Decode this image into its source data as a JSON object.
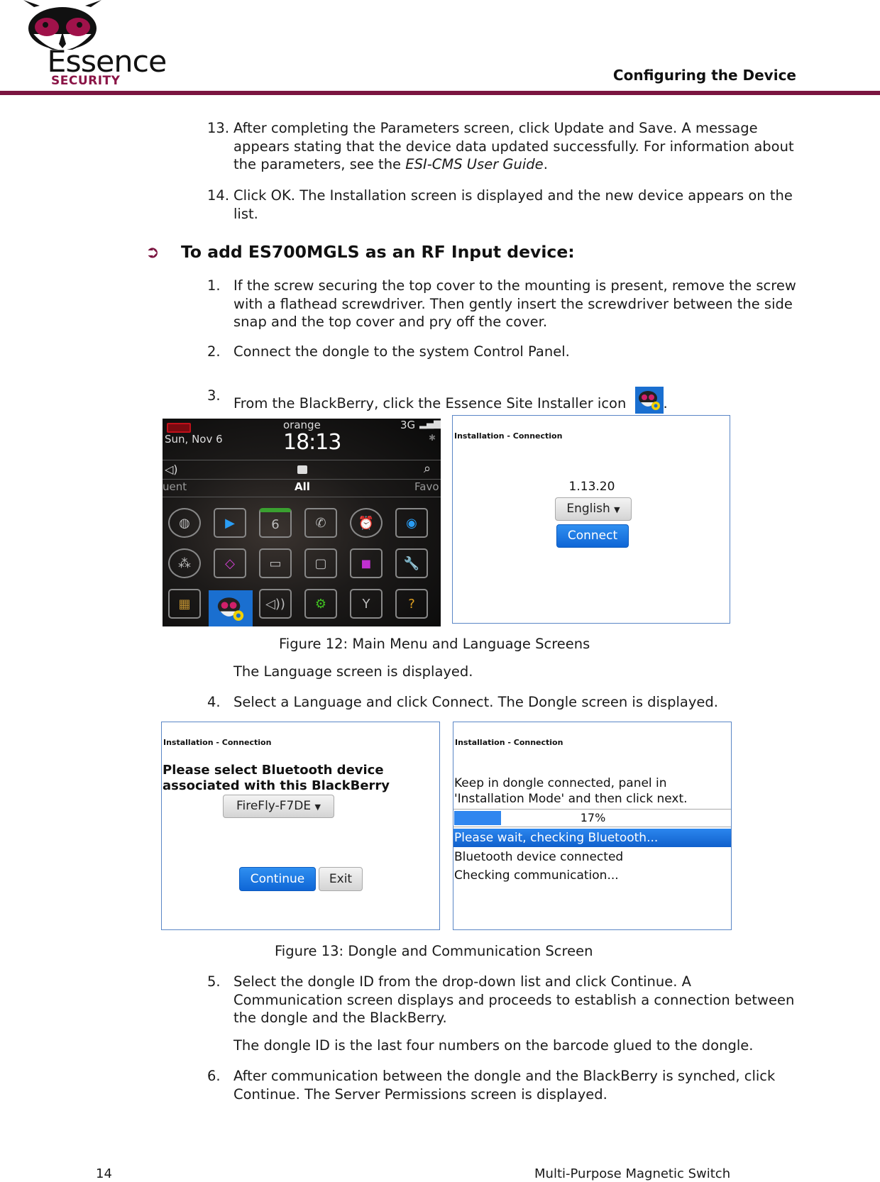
{
  "header": {
    "logo_word": "Essence",
    "logo_sub": "SECURITY",
    "section_title": "Configuring the Device",
    "accent_color": "#7b1540"
  },
  "steps_prev": [
    {
      "num": "13.",
      "text_a": "After completing the Parameters screen, click Update and Save. A message appears stating that the device data updated successfully. For information about the parameters, see the ",
      "text_em": "ESI-CMS User Guide",
      "text_b": "."
    },
    {
      "num": "14.",
      "text": "Click OK. The Installation screen is displayed and the new device appears on the list."
    }
  ],
  "procedure": {
    "arrow": "➲",
    "title": "To add ES700MGLS as an RF Input device:",
    "steps": [
      {
        "num": "1.",
        "text": "If the screw securing the top cover to the mounting is present, remove the screw with a flathead screwdriver. Then gently insert the screwdriver between the side snap and the top cover and pry off the cover."
      },
      {
        "num": "2.",
        "text": "Connect the dongle to the system Control Panel."
      },
      {
        "num": "3.",
        "text": "From the BlackBerry, click the Essence Site Installer icon",
        "suffix": "."
      },
      {
        "num": "4.",
        "text": "Select a Language and click Connect. The Dongle screen is displayed."
      },
      {
        "num": "5.",
        "text": "Select the dongle ID from the drop-down list and click Continue. A Communication screen displays and proceeds to establish a connection between the dongle and the BlackBerry."
      },
      {
        "num": "6.",
        "text": "After communication between the dongle and the BlackBerry is synched, click Continue. The Server Permissions screen is displayed."
      }
    ],
    "note_after_fig12": "The Language screen is displayed.",
    "note_after_step5": "The dongle ID is the last four numbers on the barcode glued to the dongle."
  },
  "figure12": {
    "caption": "Figure 12: Main Menu and Language Screens",
    "phone": {
      "carrier": "orange",
      "time": "18:13",
      "date": "Sun, Nov 6",
      "network": "3G",
      "tabs": [
        "uent",
        "All",
        "Favo"
      ],
      "calendar_day": "6",
      "icons": [
        "browser-icon",
        "media-icon",
        "calendar-icon",
        "phone-icon",
        "clock-icon",
        "camera-icon",
        "blackberry-icon",
        "maps-icon",
        "messages-icon",
        "folder-icon",
        "games-icon",
        "options-icon",
        "sim-icon",
        "essence-site-installer-icon",
        "sound-icon",
        "setup-icon",
        "network-icon",
        "help-icon"
      ]
    },
    "language_screen": {
      "title": "Installation - Connection",
      "version": "1.13.20",
      "language_selected": "English",
      "connect_label": "Connect"
    }
  },
  "figure13": {
    "caption": "Figure 13: Dongle and Communication Screen",
    "dongle_screen": {
      "title": "Installation - Connection",
      "prompt_line1": "Please select Bluetooth device",
      "prompt_line2": "associated with this BlackBerry",
      "device_selected": "FireFly-F7DE",
      "continue_label": "Continue",
      "exit_label": "Exit"
    },
    "communication_screen": {
      "title": "Installation - Connection",
      "message_line1": "Keep in dongle connected, panel in",
      "message_line2": "'Installation Mode' and then click next.",
      "progress_percent": 17,
      "progress_label": "17%",
      "log": [
        "Please wait, checking Bluetooth...",
        "Bluetooth device connected",
        "Checking communication..."
      ]
    }
  },
  "footer": {
    "page_number": "14",
    "doc_title": "Multi-Purpose Magnetic Switch"
  }
}
